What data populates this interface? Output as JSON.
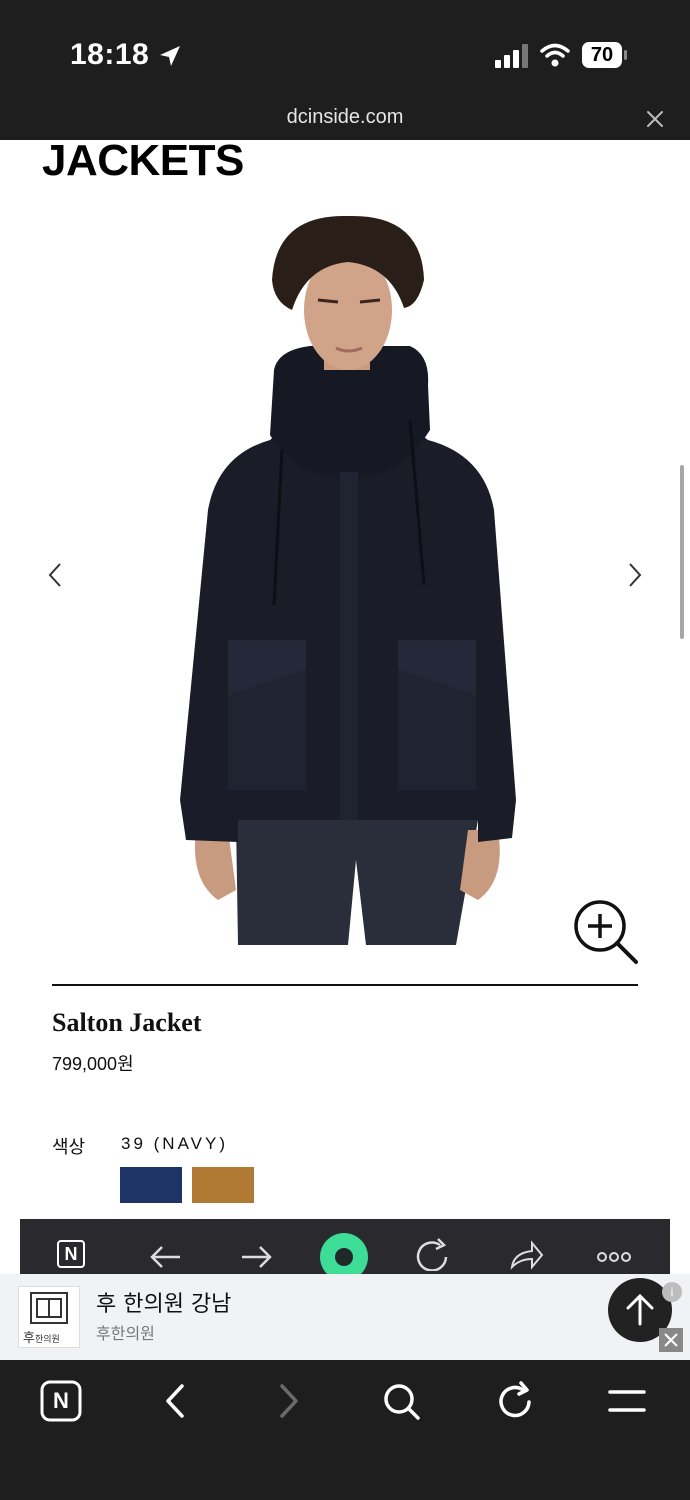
{
  "status_bar": {
    "time": "18:18",
    "battery": "70",
    "icons": [
      "location-arrow-icon",
      "cellular-signal-icon",
      "wifi-icon",
      "battery-icon"
    ]
  },
  "browser": {
    "url": "dcinside.com"
  },
  "page": {
    "title": "JACKETS",
    "product": {
      "name": "Salton Jacket",
      "price": "799,000원",
      "color_label": "색상",
      "color_value": "39 (NAVY)",
      "swatches": [
        {
          "name": "navy",
          "color": "#1f3466"
        },
        {
          "name": "brown",
          "color": "#b07a34"
        }
      ]
    }
  },
  "inpage_toolbar": {
    "items": [
      "n-logo-icon",
      "back-arrow-icon",
      "forward-arrow-icon",
      "green-dot-icon",
      "refresh-icon",
      "share-icon",
      "more-icon"
    ],
    "n_label": "N"
  },
  "ad": {
    "title": "후 한의원 강남",
    "subtitle": "후한의원",
    "logo_text": "후",
    "logo_subtext": "한의원",
    "info": "i"
  },
  "bottom_bar": {
    "n_label": "N",
    "items": [
      "n-logo-icon",
      "back-chevron-icon",
      "forward-chevron-icon",
      "search-icon",
      "refresh-icon",
      "menu-icon"
    ]
  },
  "colors": {
    "bar_bg": "#1e1e1e",
    "accent_green": "#3ddc97"
  }
}
